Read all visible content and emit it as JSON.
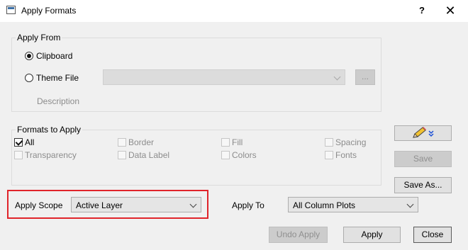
{
  "window": {
    "title": "Apply Formats",
    "help_label": "?",
    "close_glyph": "✕"
  },
  "apply_from": {
    "legend": "Apply From",
    "clipboard_label": "Clipboard",
    "theme_file_label": "Theme File",
    "theme_file_value": "",
    "browse_label": "...",
    "description_label": "Description",
    "selected": "Clipboard"
  },
  "formats": {
    "legend": "Formats to Apply",
    "items": [
      {
        "label": "All",
        "checked": true,
        "enabled": true
      },
      {
        "label": "Border",
        "checked": false,
        "enabled": false
      },
      {
        "label": "Fill",
        "checked": false,
        "enabled": false
      },
      {
        "label": "Spacing",
        "checked": false,
        "enabled": false
      },
      {
        "label": "Transparency",
        "checked": false,
        "enabled": false
      },
      {
        "label": "Data Label",
        "checked": false,
        "enabled": false
      },
      {
        "label": "Colors",
        "checked": false,
        "enabled": false
      },
      {
        "label": "Fonts",
        "checked": false,
        "enabled": false
      }
    ]
  },
  "side_buttons": {
    "edit_icon": "pencil-icon",
    "save_label": "Save",
    "save_as_label": "Save As..."
  },
  "scope": {
    "label": "Apply Scope",
    "value": "Active Layer"
  },
  "apply_to": {
    "label": "Apply To",
    "value": "All Column Plots"
  },
  "footer": {
    "undo_label": "Undo Apply",
    "apply_label": "Apply",
    "close_label": "Close"
  },
  "colors": {
    "highlight": "#e0242a",
    "accent": "#1a4fd6"
  }
}
